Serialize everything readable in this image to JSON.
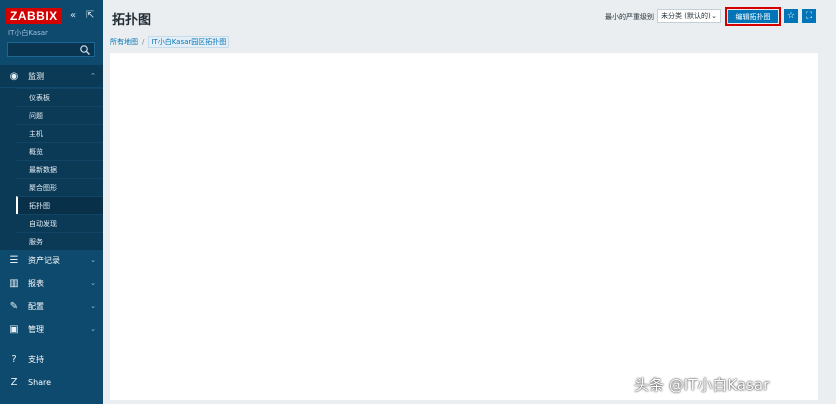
{
  "sidebar": {
    "logo": "ZABBIX",
    "collapse_glyph": "«",
    "kiosk_glyph": "⇱",
    "instance_name": "IT小白Kasar",
    "search": {
      "value": "",
      "placeholder": ""
    },
    "sections": [
      {
        "label": "监测",
        "icon": "eye-icon",
        "glyph": "◉",
        "chevron": "⌃"
      },
      {
        "label": "资产记录",
        "icon": "list-icon",
        "glyph": "☰",
        "chevron": "⌄"
      },
      {
        "label": "报表",
        "icon": "chart-icon",
        "glyph": "▥",
        "chevron": "⌄"
      },
      {
        "label": "配置",
        "icon": "wrench-icon",
        "glyph": "✎",
        "chevron": "⌄"
      },
      {
        "label": "管理",
        "icon": "admin-icon",
        "glyph": "▣",
        "chevron": "⌄"
      }
    ],
    "monitoring_items": [
      "仪表板",
      "问题",
      "主机",
      "概览",
      "最新数据",
      "聚合图形",
      "拓扑图",
      "自动发现",
      "服务"
    ],
    "support": {
      "label": "支持",
      "icon": "support-icon",
      "glyph": "?"
    },
    "share": {
      "label": "Share",
      "icon": "share-icon",
      "glyph": "Z"
    }
  },
  "header": {
    "title": "拓扑图",
    "min_severity_label": "最小的严重级别",
    "severity_select_value": "未分类 (默认的)",
    "edit_map_button": "编辑拓扑图",
    "favorite_icon": "star-icon",
    "fullscreen_icon": "fullscreen-icon"
  },
  "breadcrumb": {
    "all_maps": "所有地图",
    "separator": "/",
    "current": "IT小白Kasar园区拓扑图"
  },
  "watermark": "头条 @IT小白Kasar",
  "colors": {
    "sidebar": "#0e4a6e",
    "accent": "#0275b8",
    "logo_red": "#d40000",
    "highlight_border": "#d40000"
  }
}
